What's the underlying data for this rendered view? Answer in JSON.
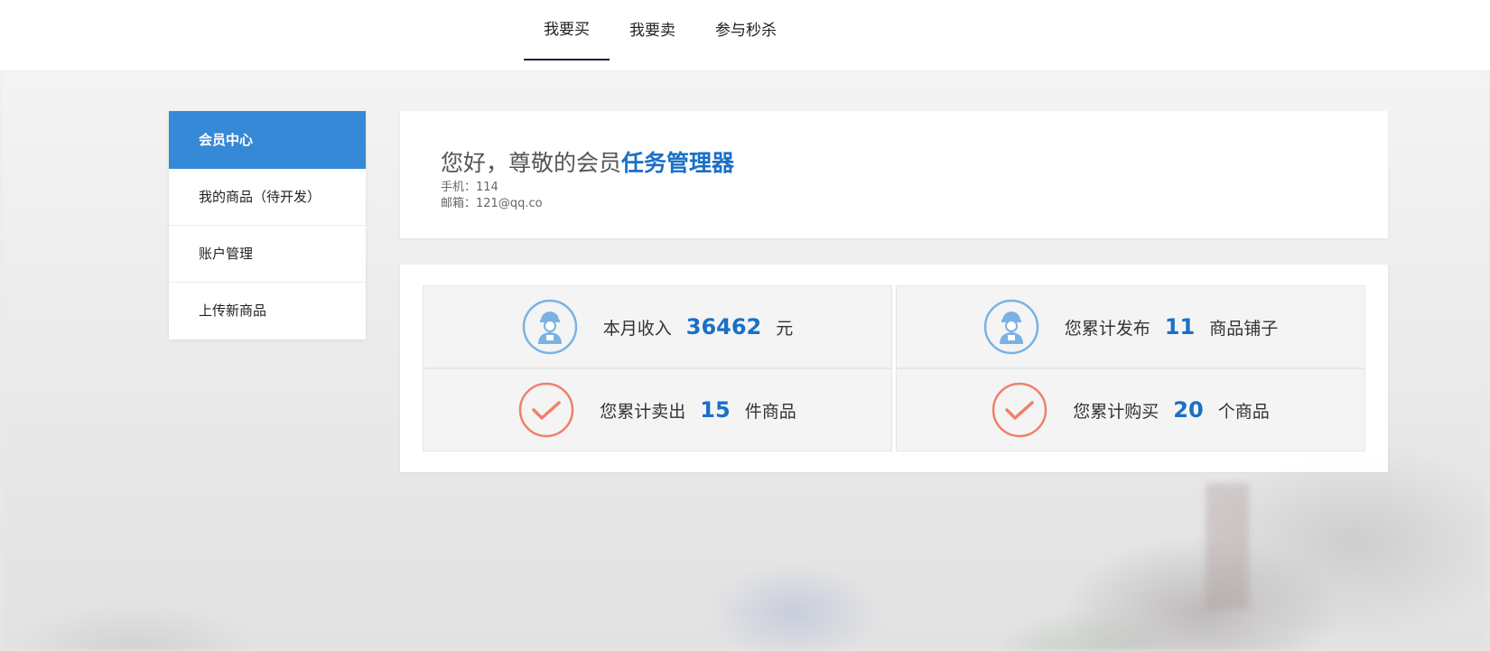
{
  "nav": {
    "items": [
      {
        "label": "我要买",
        "active": true
      },
      {
        "label": "我要卖",
        "active": false
      },
      {
        "label": "参与秒杀",
        "active": false
      }
    ]
  },
  "sidebar": {
    "items": [
      {
        "label": "会员中心",
        "active": true
      },
      {
        "label": "我的商品（待开发）",
        "active": false
      },
      {
        "label": "账户管理",
        "active": false
      },
      {
        "label": "上传新商品",
        "active": false
      }
    ]
  },
  "welcome": {
    "greeting": "您好，尊敬的会员",
    "username": "任务管理器",
    "phone": "手机：114",
    "email": "邮箱：121@qq.co"
  },
  "stats": {
    "income": {
      "prefix": "本月收入",
      "value": "36462",
      "suffix": "元",
      "icon": "worker-avatar-icon"
    },
    "published": {
      "prefix": "您累计发布",
      "value": "11",
      "suffix": "商品铺子",
      "icon": "worker-avatar-icon"
    },
    "sold": {
      "prefix": "您累计卖出",
      "value": "15",
      "suffix": "件商品",
      "icon": "check-circle-icon"
    },
    "bought": {
      "prefix": "您累计购买",
      "value": "20",
      "suffix": "个商品",
      "icon": "check-circle-icon"
    }
  },
  "colors": {
    "accent": "#3589d6",
    "highlight": "#1a6fc7",
    "check": "#f0806a",
    "avatar": "#7ab2e3"
  }
}
